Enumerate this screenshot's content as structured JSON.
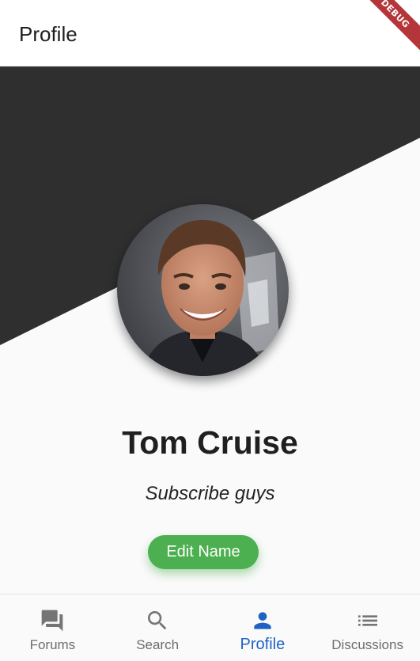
{
  "appbar": {
    "title": "Profile",
    "debug_banner": "DEBUG"
  },
  "profile": {
    "name": "Tom Cruise",
    "subtitle": "Subscribe guys",
    "edit_label": "Edit Name"
  },
  "bottom_nav": {
    "items": [
      {
        "label": "Forums",
        "icon": "forum-icon",
        "active": false
      },
      {
        "label": "Search",
        "icon": "search-icon",
        "active": false
      },
      {
        "label": "Profile",
        "icon": "person-icon",
        "active": true
      },
      {
        "label": "Discussions",
        "icon": "list-icon",
        "active": false
      }
    ]
  },
  "colors": {
    "header_dark": "#2f2f2f",
    "accent_green": "#4caf50",
    "active_blue": "#1e63c4",
    "inactive_gray": "#757575",
    "background": "#fafafa"
  }
}
